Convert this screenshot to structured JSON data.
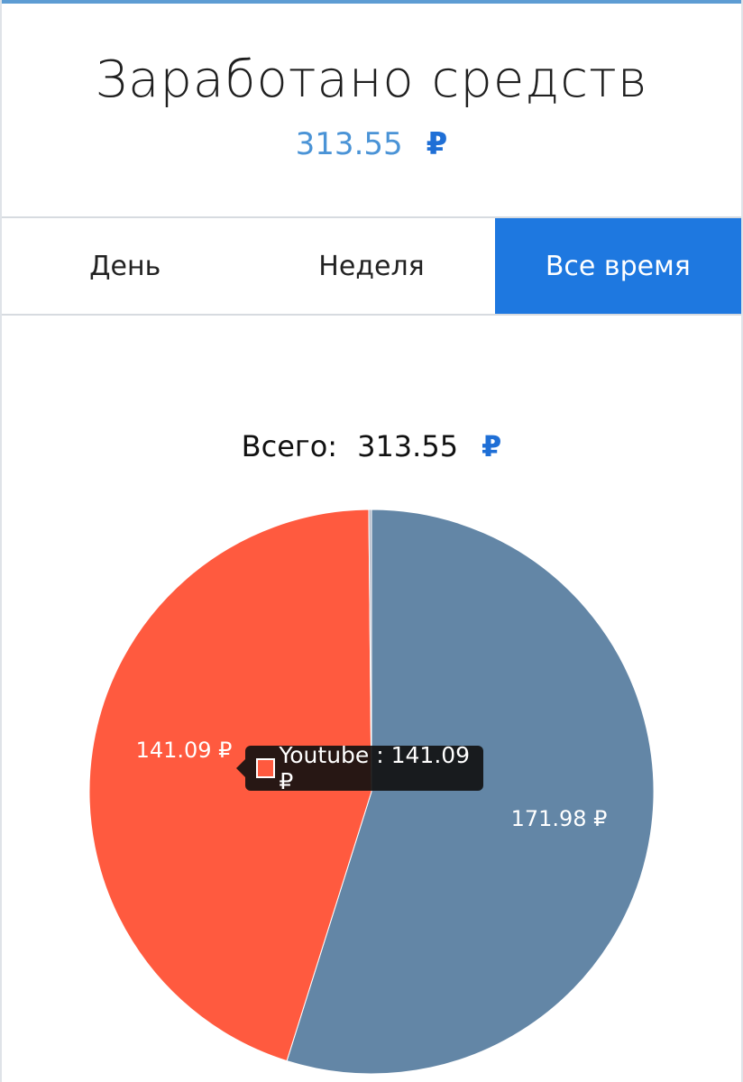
{
  "header": {
    "title": "Заработано средств",
    "amount": "313.55",
    "currency": "₽"
  },
  "tabs": [
    {
      "label": "День",
      "active": false
    },
    {
      "label": "Неделя",
      "active": false
    },
    {
      "label": "Все время",
      "active": true
    }
  ],
  "summary": {
    "label": "Всего:",
    "value": "313.55",
    "currency": "₽"
  },
  "tooltip": {
    "text": "Youtube : 141.09 ₽",
    "swatch_color": "#ff5a3f"
  },
  "chart_data": {
    "type": "pie",
    "slices": [
      {
        "value": 171.98,
        "label": "171.98 ₽",
        "color": "#6386a6"
      },
      {
        "value": 141.09,
        "label": "141.09 ₽",
        "color": "#ff5a3f",
        "name": "Youtube"
      },
      {
        "value": 0.48,
        "label": "",
        "color": "#b0b6c6"
      }
    ]
  },
  "colors": {
    "accent": "#1e78e0",
    "amount_text": "#4a93d6"
  }
}
